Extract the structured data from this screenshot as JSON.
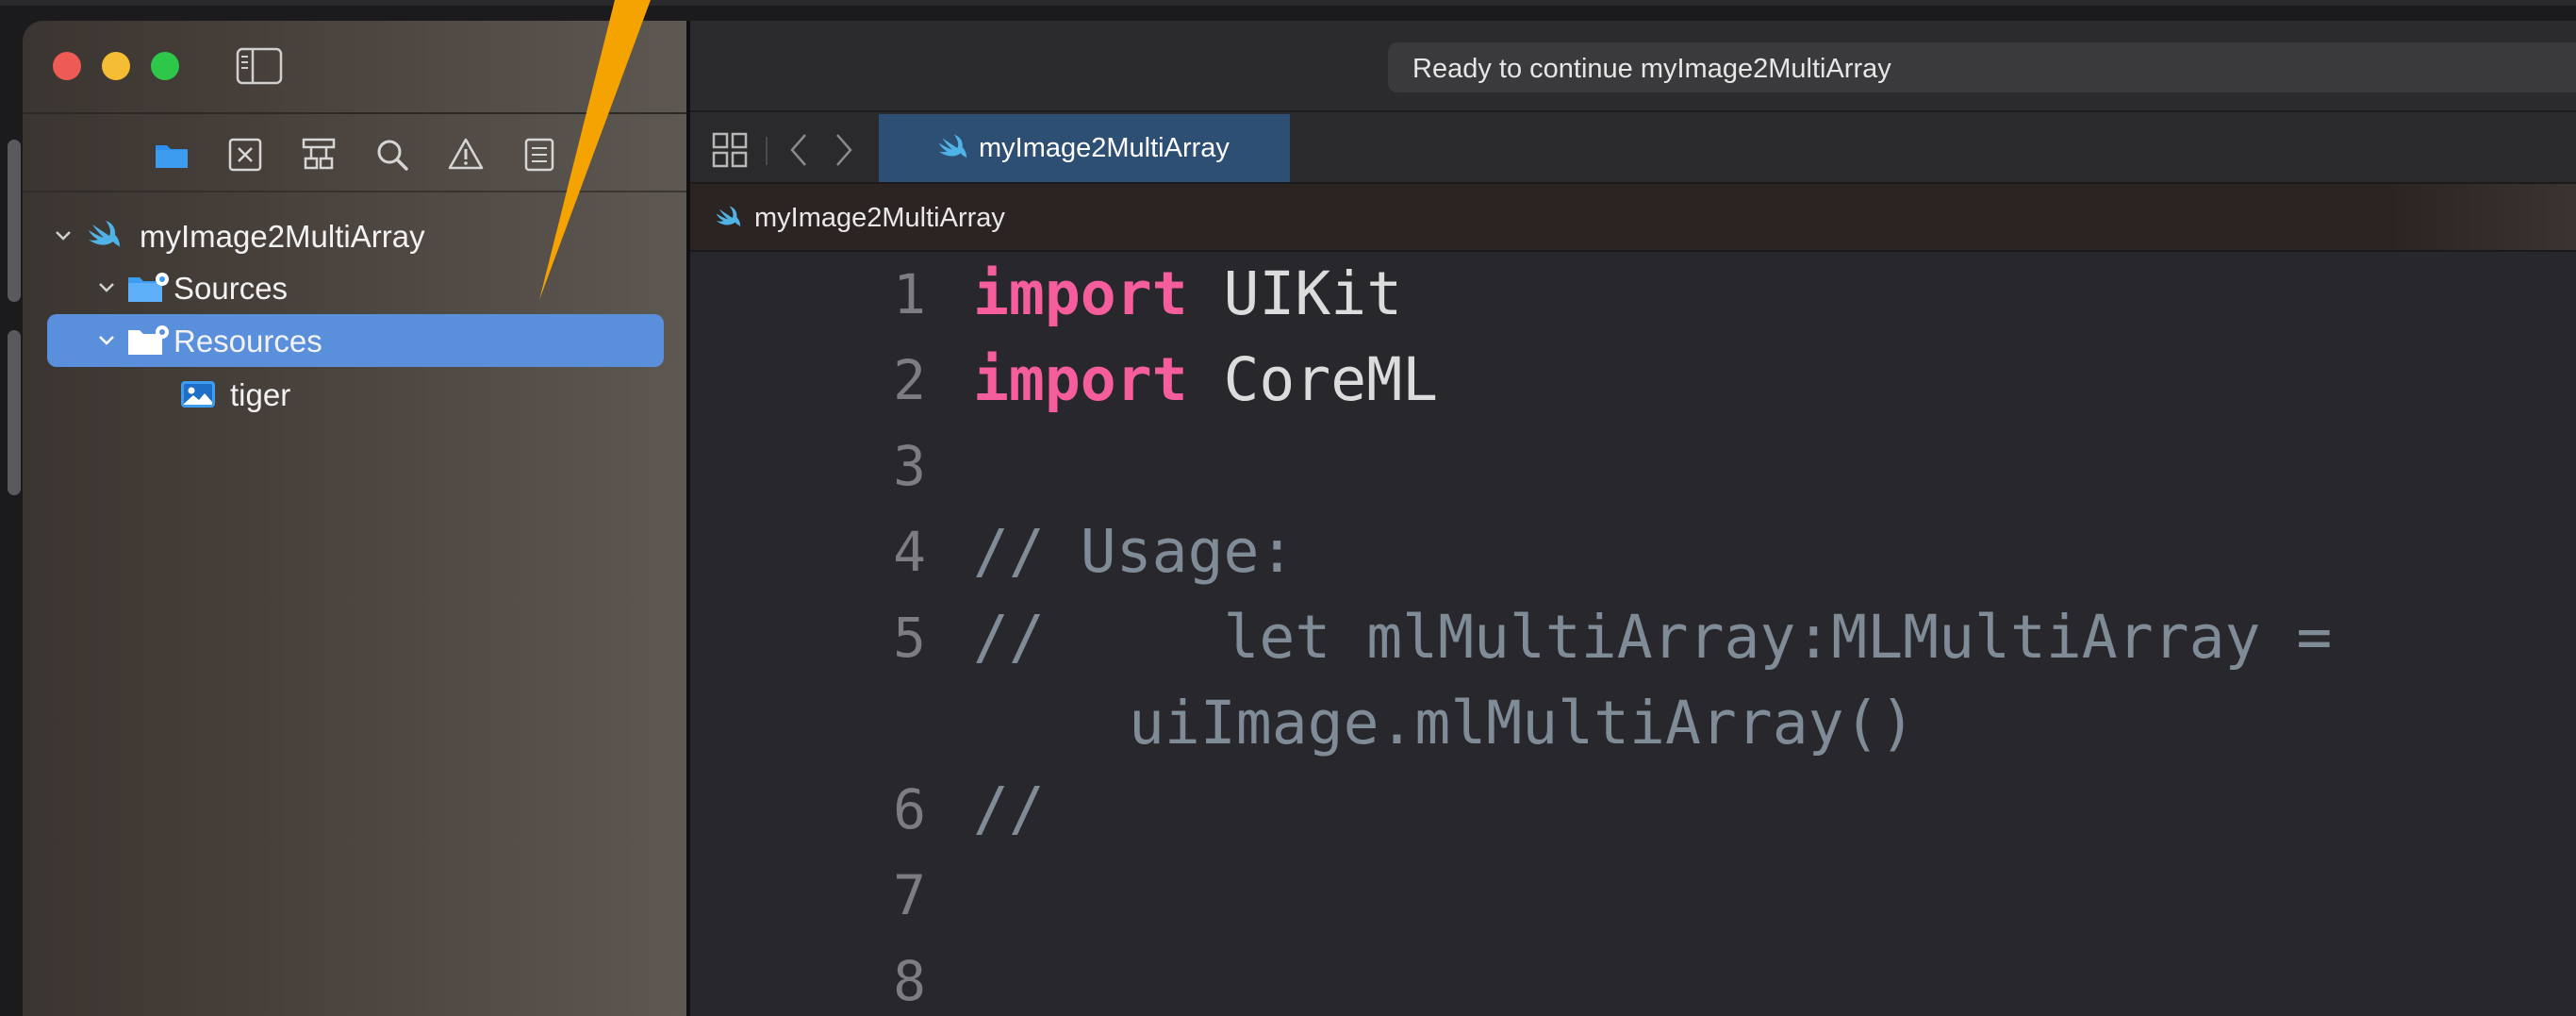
{
  "window": {
    "status": "Ready to continue myImage2MultiArray"
  },
  "navigator": {
    "tabs": [
      {
        "name": "project-navigator",
        "icon": "folder-icon",
        "active": true
      },
      {
        "name": "issue-navigator",
        "icon": "x-box-icon",
        "active": false
      },
      {
        "name": "hierarchy-navigator",
        "icon": "hierarchy-icon",
        "active": false
      },
      {
        "name": "find-navigator",
        "icon": "search-icon",
        "active": false
      },
      {
        "name": "warning-navigator",
        "icon": "warning-icon",
        "active": false
      },
      {
        "name": "report-navigator",
        "icon": "list-icon",
        "active": false
      }
    ],
    "tree": [
      {
        "label": "myImage2MultiArray",
        "icon": "swift-icon",
        "level": 0,
        "expanded": true
      },
      {
        "label": "Sources",
        "icon": "folder-gear-icon",
        "level": 1,
        "expanded": true
      },
      {
        "label": "Resources",
        "icon": "folder-gear-icon",
        "level": 1,
        "expanded": true,
        "selected": true
      },
      {
        "label": "tiger",
        "icon": "image-icon",
        "level": 2
      }
    ]
  },
  "editor": {
    "tab_label": "myImage2MultiArray",
    "breadcrumb": "myImage2MultiArray",
    "lines": [
      {
        "n": "1",
        "kw": "import",
        "text": " UIKit"
      },
      {
        "n": "2",
        "kw": "import",
        "text": " CoreML"
      },
      {
        "n": "3",
        "text": ""
      },
      {
        "n": "4",
        "comment": "// Usage:"
      },
      {
        "n": "5",
        "comment": "//     let mlMultiArray:MLMultiArray =",
        "cont": "uiImage.mlMultiArray()"
      },
      {
        "n": "6",
        "comment": "//"
      },
      {
        "n": "7",
        "text": ""
      },
      {
        "n": "8",
        "text": ""
      }
    ]
  },
  "colors": {
    "keyword": "#f65d9c",
    "comment": "#7f8c98",
    "selection": "#5a8fdc",
    "active_tab": "#2e4f74",
    "swift_icon": "#4fb3e6",
    "folder_icon": "#3b9cf0",
    "callout_arrow": "#f5a300"
  }
}
